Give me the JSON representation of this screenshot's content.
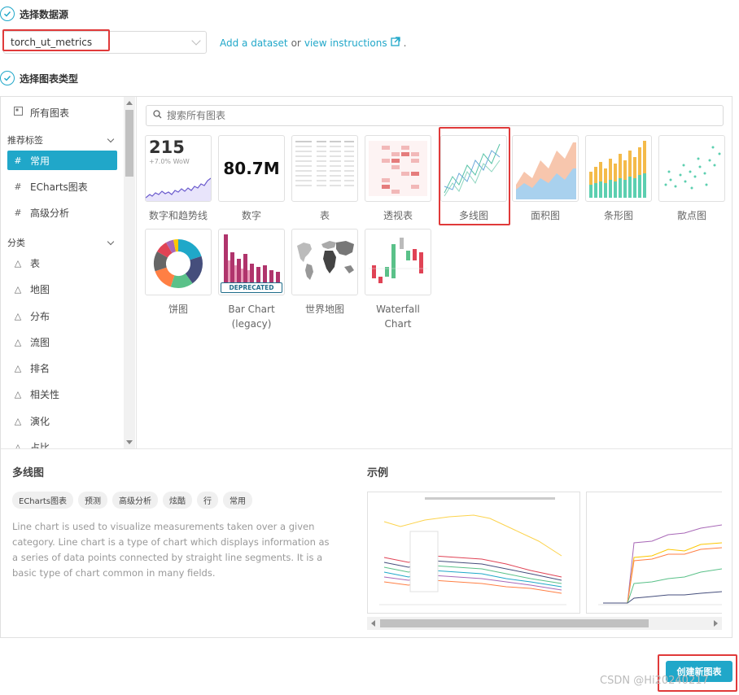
{
  "step1": {
    "label": "选择数据源"
  },
  "datasource": {
    "value": "torch_ut_metrics",
    "add_dataset": "Add a dataset",
    "or": "or",
    "view_instructions": "view instructions",
    "period": "."
  },
  "step2": {
    "label": "选择图表类型"
  },
  "sidebar": {
    "all_charts": "所有图表",
    "recommended_header": "推荐标签",
    "recommended": [
      "常用",
      "ECharts图表",
      "高级分析"
    ],
    "category_header": "分类",
    "categories": [
      "表",
      "地图",
      "分布",
      "流图",
      "排名",
      "相关性",
      "演化",
      "占比"
    ]
  },
  "search": {
    "placeholder": "搜索所有图表"
  },
  "tiles": {
    "big_number_trend": {
      "name": "数字和趋势线",
      "value": "215",
      "sub": "+7.0% WoW"
    },
    "big_number": {
      "name": "数字",
      "value": "80.7M"
    },
    "table": {
      "name": "表"
    },
    "pivot": {
      "name": "透视表"
    },
    "line": {
      "name": "多线图"
    },
    "area": {
      "name": "面积图"
    },
    "bar": {
      "name": "条形图"
    },
    "scatter": {
      "name": "散点图"
    },
    "pie": {
      "name": "饼图"
    },
    "bar_legacy": {
      "name_line1": "Bar Chart",
      "name_line2": "(legacy)",
      "badge": "DEPRECATED"
    },
    "world_map": {
      "name": "世界地图"
    },
    "waterfall": {
      "name_line1": "Waterfall",
      "name_line2": "Chart"
    }
  },
  "details": {
    "title": "多线图",
    "tags": [
      "ECharts图表",
      "预测",
      "高级分析",
      "炫酷",
      "行",
      "常用"
    ],
    "description": "Line chart is used to visualize measurements taken over a given category. Line chart is a type of chart which displays information as a series of data points connected by straight line segments. It is a basic type of chart common in many fields.",
    "example_title": "示例"
  },
  "create_button": "创建新图表",
  "watermark": "CSDN @Hi20240217",
  "colors": {
    "accent": "#20a7c9",
    "highlight": "#e03a3a"
  }
}
